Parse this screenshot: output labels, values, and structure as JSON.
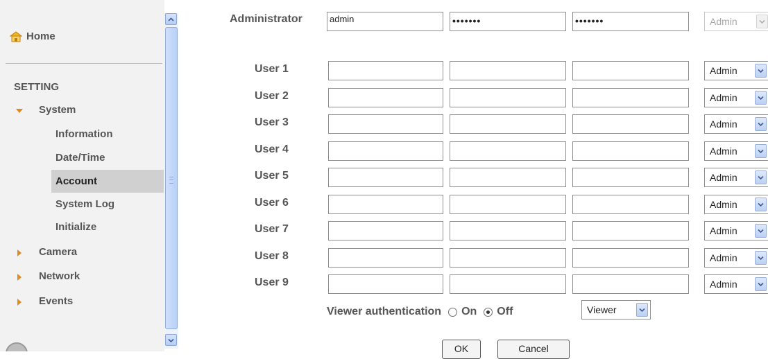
{
  "sidebar": {
    "home_label": "Home",
    "section_label": "SETTING",
    "nav": [
      {
        "label": "System",
        "expanded": true
      },
      {
        "label": "Camera",
        "expanded": false
      },
      {
        "label": "Network",
        "expanded": false
      },
      {
        "label": "Events",
        "expanded": false
      }
    ],
    "system_items": [
      "Information",
      "Date/Time",
      "Account",
      "System Log",
      "Initialize"
    ],
    "active_item": "Account"
  },
  "form": {
    "admin": {
      "label": "Administrator",
      "username": "admin",
      "password": "•••••••",
      "confirm": "•••••••",
      "role": "Admin"
    },
    "users": [
      {
        "label": "User 1",
        "role": "Admin"
      },
      {
        "label": "User 2",
        "role": "Admin"
      },
      {
        "label": "User 3",
        "role": "Admin"
      },
      {
        "label": "User 4",
        "role": "Admin"
      },
      {
        "label": "User 5",
        "role": "Admin"
      },
      {
        "label": "User 6",
        "role": "Admin"
      },
      {
        "label": "User 7",
        "role": "Admin"
      },
      {
        "label": "User 8",
        "role": "Admin"
      },
      {
        "label": "User 9",
        "role": "Admin"
      }
    ],
    "viewer_auth": {
      "label": "Viewer authentication",
      "on_label": "On",
      "off_label": "Off",
      "selected": "Off",
      "role": "Viewer"
    },
    "ok_label": "OK",
    "cancel_label": "Cancel"
  },
  "colors": {
    "accent_arrow": "#e08a1e",
    "scrollbar": "#b8d0f7"
  }
}
